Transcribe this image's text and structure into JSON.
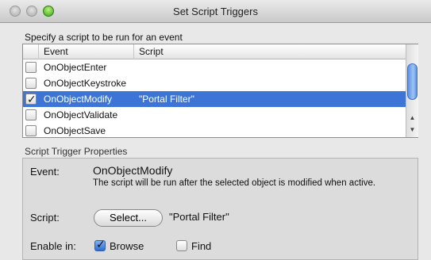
{
  "window": {
    "title": "Set Script Triggers"
  },
  "prompt": "Specify a script to be run for an event",
  "table": {
    "headers": {
      "event": "Event",
      "script": "Script"
    },
    "rows": [
      {
        "event": "OnObjectEnter",
        "script": "",
        "checked": false,
        "selected": false
      },
      {
        "event": "OnObjectKeystroke",
        "script": "",
        "checked": false,
        "selected": false
      },
      {
        "event": "OnObjectModify",
        "script": "\"Portal Filter\"",
        "checked": true,
        "selected": true
      },
      {
        "event": "OnObjectValidate",
        "script": "",
        "checked": false,
        "selected": false
      },
      {
        "event": "OnObjectSave",
        "script": "",
        "checked": false,
        "selected": false
      }
    ]
  },
  "properties": {
    "section_title": "Script Trigger Properties",
    "event_label": "Event:",
    "event_value": "OnObjectModify",
    "description": "The script will be run after the selected object is modified when active.",
    "script_label": "Script:",
    "select_button": "Select...",
    "script_value": "\"Portal Filter\"",
    "enable_label": "Enable in:",
    "browse_label": "Browse",
    "browse_checked": true,
    "find_label": "Find",
    "find_checked": false
  },
  "colors": {
    "selection": "#3d75d6",
    "accent": "#2f6cd0"
  }
}
